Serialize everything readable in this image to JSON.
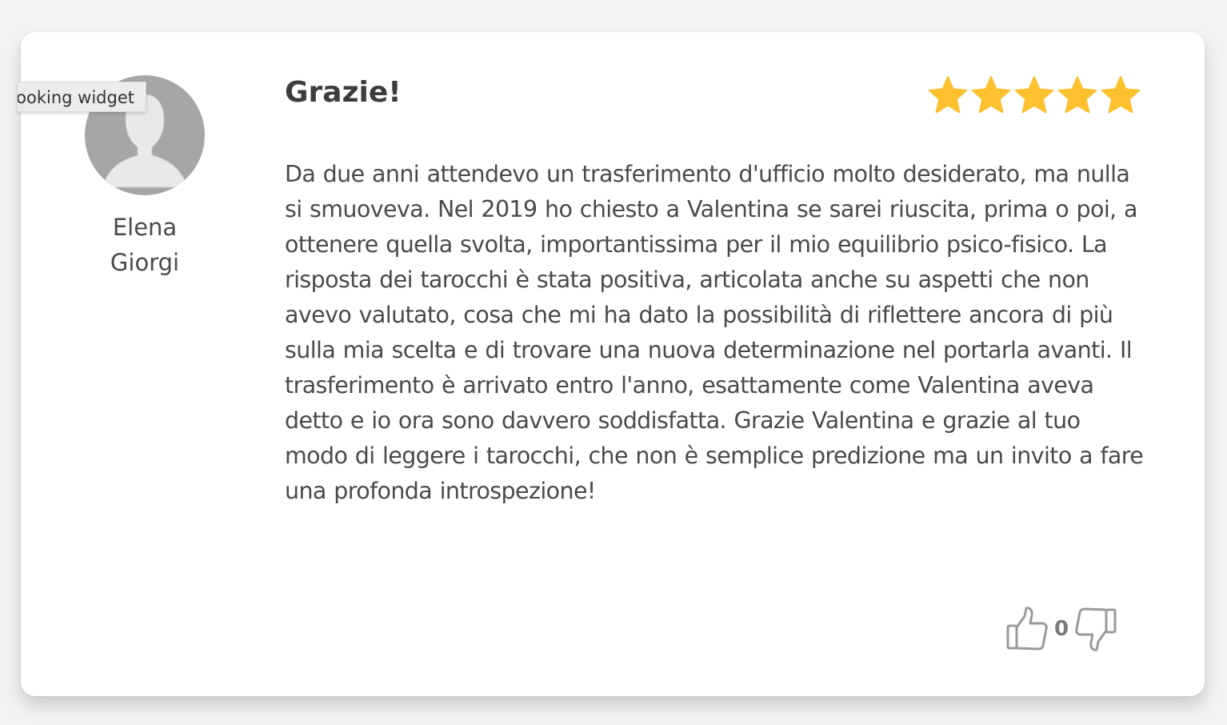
{
  "tooltip": {
    "text": "Booking widget"
  },
  "review": {
    "author_first": "Elena",
    "author_last": "Giorgi",
    "title": "Grazie!",
    "rating": 5,
    "rating_max": 5,
    "body": "Da due anni attendevo un trasferimento d'ufficio molto desiderato, ma nulla si smuoveva. Nel 2019 ho chiesto a Valentina se sarei riuscita, prima o poi, a ottenere quella svolta, importantissima per il mio equilibrio psico-fisico. La risposta dei tarocchi è stata positiva, articolata anche su aspetti che non avevo valutato, cosa che mi ha dato la possibilità di riflettere ancora di più sulla mia scelta e di trovare una nuova determinazione nel portarla avanti. Il trasferimento è arrivato entro l'anno, esattamente come Valentina aveva detto e io ora sono davvero soddisfatta. Grazie Valentina e grazie al tuo modo di leggere i tarocchi, che non è semplice predizione ma un invito a fare una profonda introspezione!",
    "vote_count": "0"
  },
  "icons": {
    "avatar": "default-user-avatar-icon",
    "star": "star-icon",
    "like": "thumbs-up-icon",
    "dislike": "thumbs-down-icon"
  },
  "colors": {
    "star": "#fdc02f",
    "avatar_bg": "#a6a6a6",
    "avatar_fg": "#e8e8e8"
  }
}
